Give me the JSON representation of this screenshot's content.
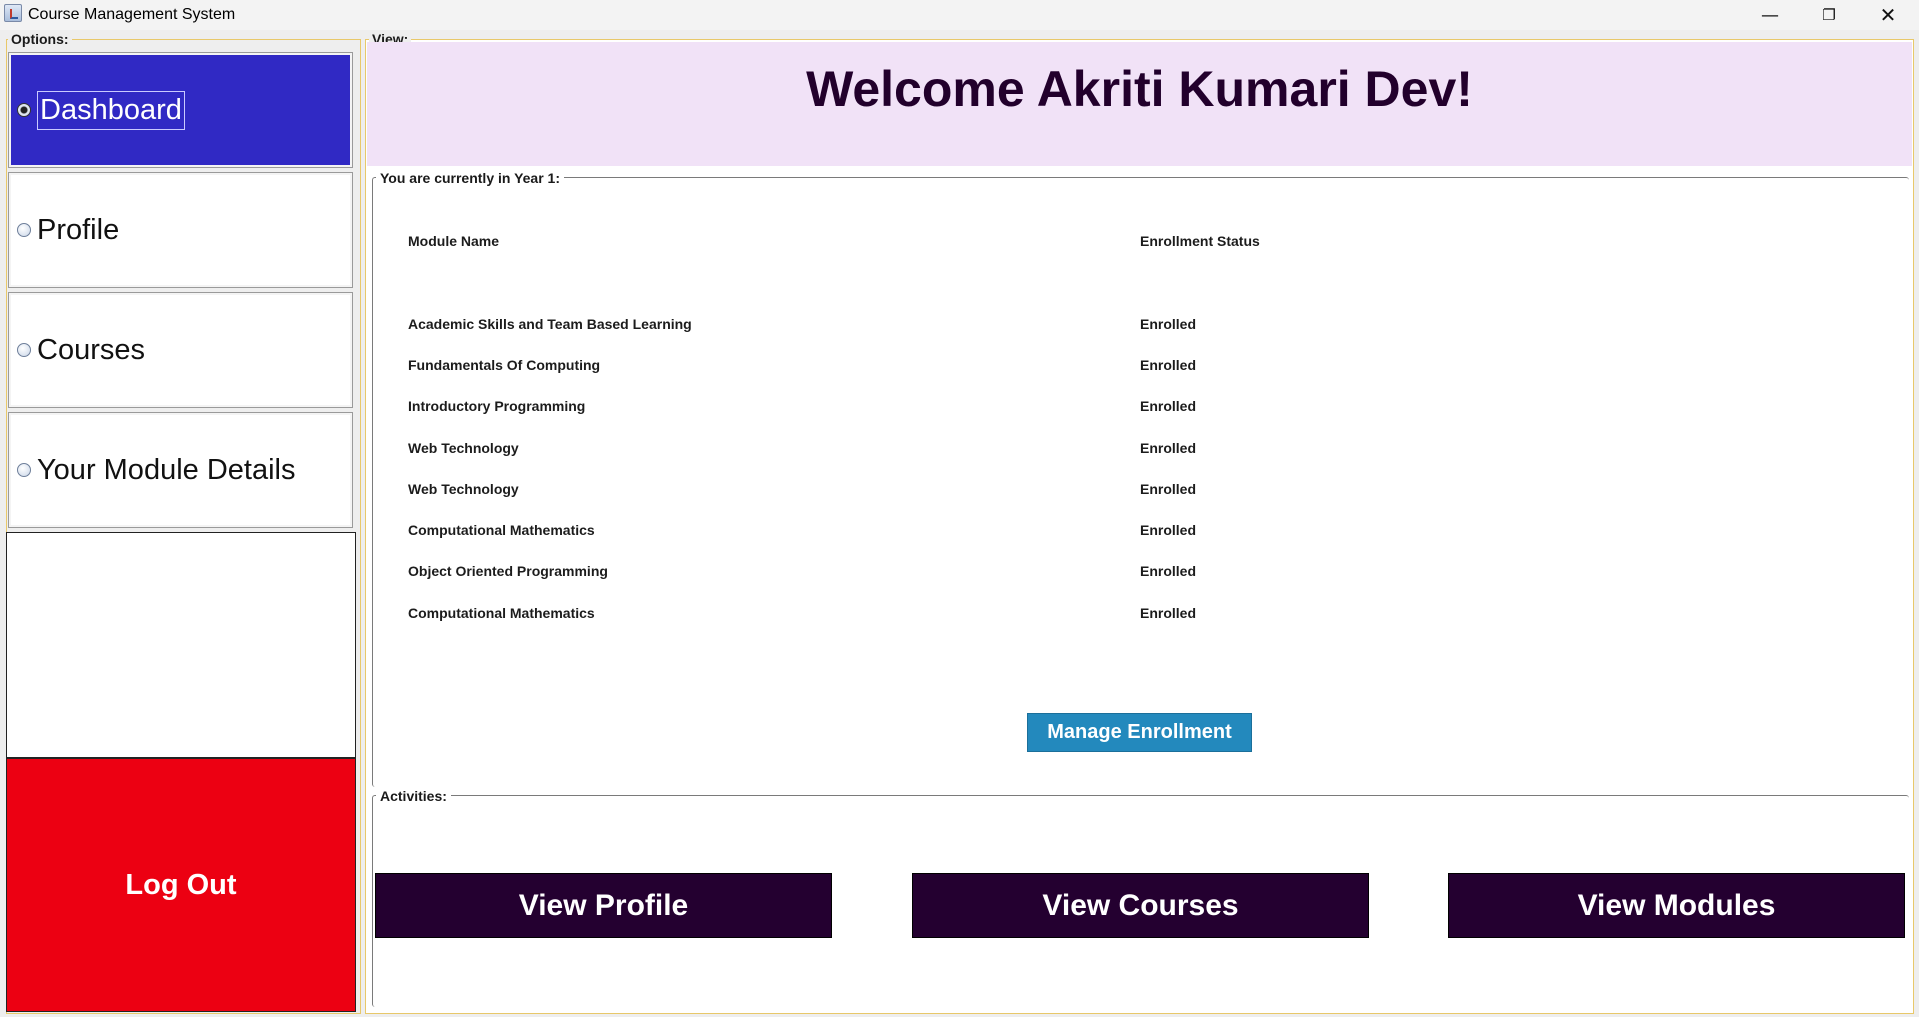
{
  "window": {
    "title": "Course Management System",
    "minimize_glyph": "—",
    "maximize_glyph": "❐",
    "close_glyph": "✕"
  },
  "options": {
    "label": "Options:",
    "items": [
      {
        "label": "Dashboard",
        "selected": true
      },
      {
        "label": "Profile",
        "selected": false
      },
      {
        "label": "Courses",
        "selected": false
      },
      {
        "label": "Your Module Details",
        "selected": false
      }
    ],
    "logout_label": "Log Out"
  },
  "view": {
    "label": "View:",
    "welcome": "Welcome Akriti Kumari Dev!",
    "year_legend": "You are currently in Year 1:",
    "table": {
      "headers": [
        "Module Name",
        "Enrollment Status"
      ],
      "rows": [
        [
          "Academic Skills and Team Based Learning",
          "Enrolled"
        ],
        [
          "Fundamentals Of Computing",
          "Enrolled"
        ],
        [
          "Introductory Programming",
          "Enrolled"
        ],
        [
          "Web Technology",
          "Enrolled"
        ],
        [
          "Web Technology",
          "Enrolled"
        ],
        [
          "Computational Mathematics",
          "Enrolled"
        ],
        [
          "Object Oriented Programming",
          "Enrolled"
        ],
        [
          "Computational Mathematics",
          "Enrolled"
        ]
      ]
    },
    "manage_label": "Manage Enrollment",
    "activities_legend": "Activities:",
    "activities": [
      "View Profile",
      "View Courses",
      "View Modules"
    ]
  },
  "colors": {
    "active_nav": "#3029c4",
    "logout": "#ec0012",
    "welcome_bg": "#f1e2f7",
    "manage_button": "#2389bd",
    "activity_button": "#240030"
  }
}
